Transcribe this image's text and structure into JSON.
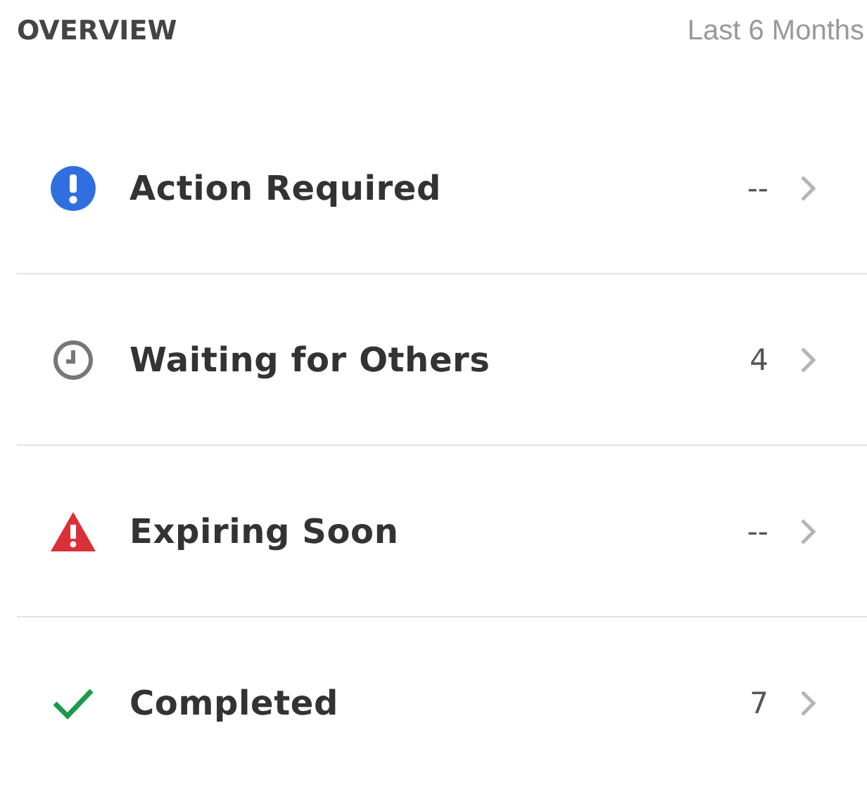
{
  "header": {
    "title": "OVERVIEW",
    "period": "Last 6 Months"
  },
  "items": [
    {
      "kind": "action",
      "label": "Action Required",
      "count": "--"
    },
    {
      "kind": "waiting",
      "label": "Waiting for Others",
      "count": "4"
    },
    {
      "kind": "expiring",
      "label": "Expiring Soon",
      "count": "--"
    },
    {
      "kind": "completed",
      "label": "Completed",
      "count": "7"
    }
  ]
}
